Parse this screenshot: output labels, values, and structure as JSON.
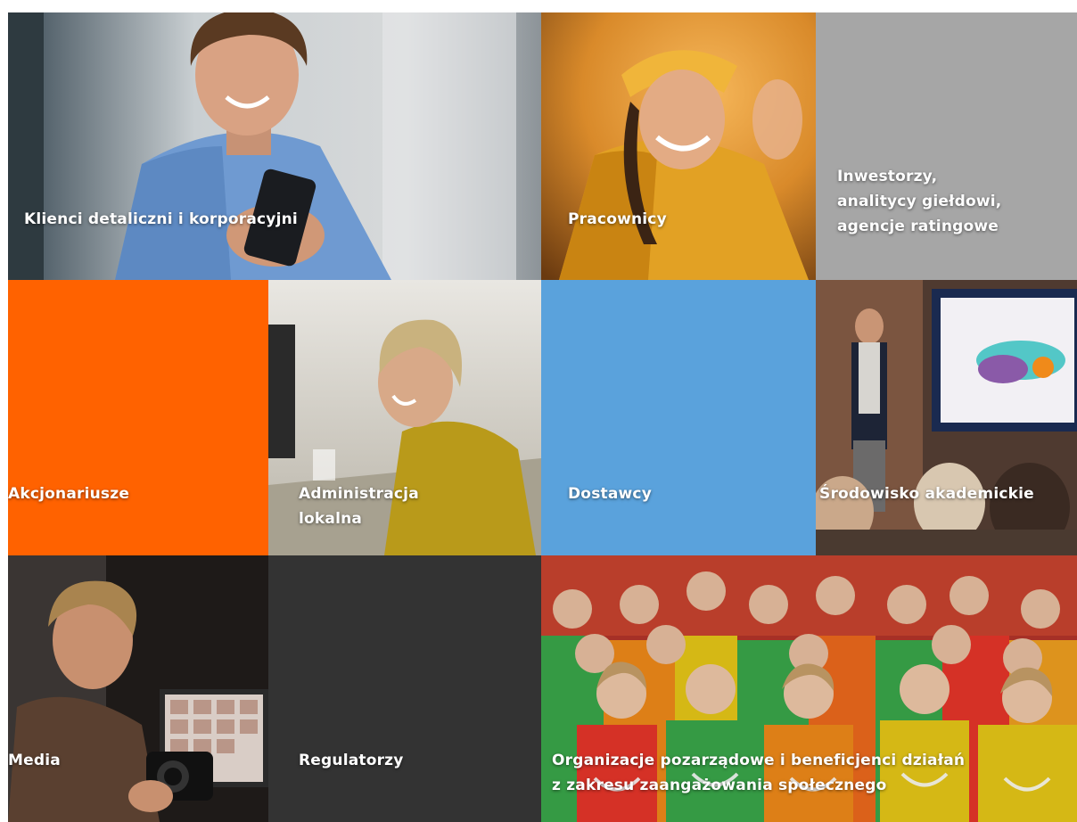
{
  "tiles": {
    "klienci": {
      "label": "Klienci detaliczni i korporacyjni",
      "image": "smiling-man-with-phone"
    },
    "pracownicy": {
      "label": "Pracownicy",
      "image": "woman-in-orange-jacket"
    },
    "inwestorzy": {
      "label": "Inwestorzy,\nanalitycy giełdowi,\nagencje ratingowe",
      "color": "#a6a6a6"
    },
    "akcjonariusze": {
      "label": "Akcjonariusze",
      "color": "#ff6200"
    },
    "administracja": {
      "label": "Administracja\nlokalna",
      "image": "woman-at-desk-computer"
    },
    "dostawcy": {
      "label": "Dostawcy",
      "color": "#5aa2dc"
    },
    "srodowisko": {
      "label": "Środowisko akademickie",
      "image": "presenter-at-screen"
    },
    "media": {
      "label": "Media",
      "image": "photographer-with-camera"
    },
    "regulatorzy": {
      "label": "Regulatorzy",
      "color": "#333333"
    },
    "organizacje": {
      "label": "Organizacje pozarządowe i beneficjenci działań\nz zakresu zaangażowania społecznego",
      "image": "group-of-children"
    }
  }
}
